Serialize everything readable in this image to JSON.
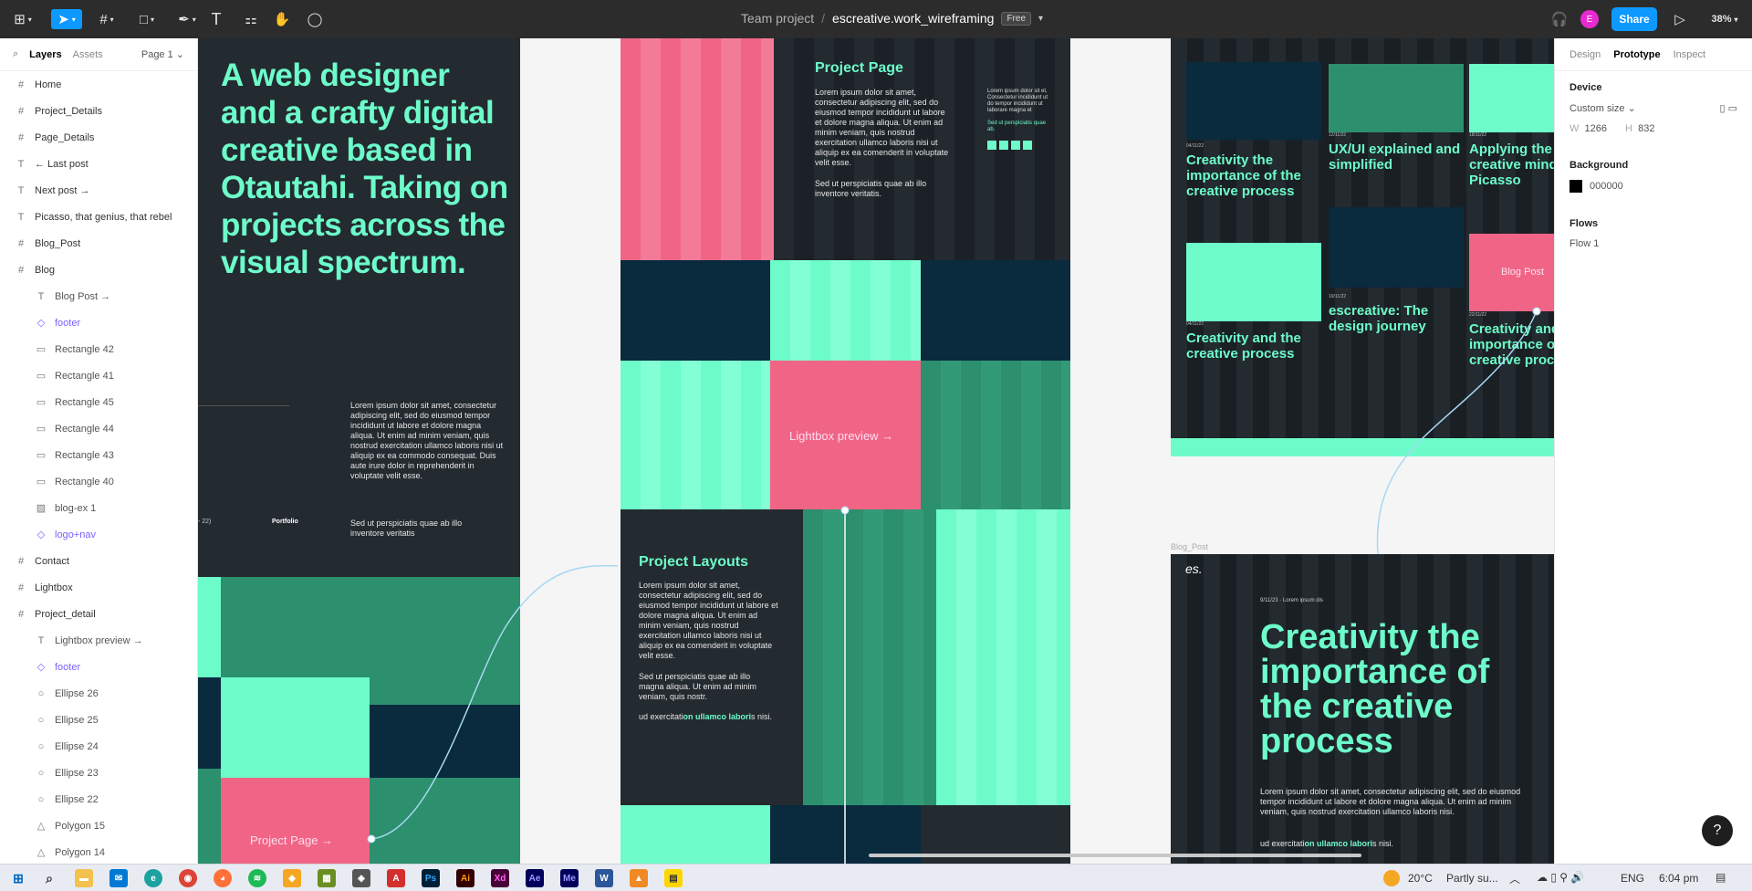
{
  "app": {
    "team": "Team project",
    "separator": "/",
    "file_name": "escreative.work_wireframing",
    "plan_badge": "Free",
    "share_label": "Share",
    "avatar_letter": "E",
    "zoom": "38%"
  },
  "left_panel": {
    "tabs": [
      "Layers",
      "Assets"
    ],
    "page": "Page 1 ⌄",
    "layers": [
      {
        "label": "Home",
        "icon": "#",
        "level": 0
      },
      {
        "label": "Project_Details",
        "icon": "#",
        "level": 0
      },
      {
        "label": "Page_Details",
        "icon": "#",
        "level": 0
      },
      {
        "label": "← Last post",
        "icon": "T",
        "level": 0
      },
      {
        "label": "Next post →",
        "icon": "T",
        "level": 0
      },
      {
        "label": "Picasso, that genius, that rebel",
        "icon": "T",
        "level": 0
      },
      {
        "label": "Blog_Post",
        "icon": "#",
        "level": 0
      },
      {
        "label": "Blog",
        "icon": "#",
        "level": 0
      },
      {
        "label": "Blog Post →",
        "icon": "T",
        "level": 1
      },
      {
        "label": "footer",
        "icon": "◇",
        "level": 1,
        "component": true
      },
      {
        "label": "Rectangle 42",
        "icon": "▭",
        "level": 1
      },
      {
        "label": "Rectangle 41",
        "icon": "▭",
        "level": 1
      },
      {
        "label": "Rectangle 45",
        "icon": "▭",
        "level": 1
      },
      {
        "label": "Rectangle 44",
        "icon": "▭",
        "level": 1
      },
      {
        "label": "Rectangle 43",
        "icon": "▭",
        "level": 1
      },
      {
        "label": "Rectangle 40",
        "icon": "▭",
        "level": 1
      },
      {
        "label": "blog-ex 1",
        "icon": "▨",
        "level": 1
      },
      {
        "label": "logo+nav",
        "icon": "◇",
        "level": 1,
        "component": true
      },
      {
        "label": "Contact",
        "icon": "#",
        "level": 0
      },
      {
        "label": "Lightbox",
        "icon": "#",
        "level": 0
      },
      {
        "label": "Project_detail",
        "icon": "#",
        "level": 0
      },
      {
        "label": "Lightbox preview →",
        "icon": "T",
        "level": 1
      },
      {
        "label": "footer",
        "icon": "◇",
        "level": 1,
        "component": true
      },
      {
        "label": "Ellipse 26",
        "icon": "○",
        "level": 1
      },
      {
        "label": "Ellipse 25",
        "icon": "○",
        "level": 1
      },
      {
        "label": "Ellipse 24",
        "icon": "○",
        "level": 1
      },
      {
        "label": "Ellipse 23",
        "icon": "○",
        "level": 1
      },
      {
        "label": "Ellipse 22",
        "icon": "○",
        "level": 1
      },
      {
        "label": "Polygon 15",
        "icon": "△",
        "level": 1
      },
      {
        "label": "Polygon 14",
        "icon": "△",
        "level": 1
      }
    ]
  },
  "canvas": {
    "home": {
      "headline": "A web designer and a crafty digital creative  based in Otautahi. Taking on projects across the visual spectrum.",
      "body": "Lorem ipsum dolor sit amet, consectetur adipiscing elit, sed do eiusmod tempor incididunt ut labore et dolore magna aliqua. Ut enim ad minim veniam, quis nostrud exercitation ullamco laboris nisi ut aliquip ex ea commodo consequat. Duis aute irure dolor in reprehenderit in voluptate velit esse.",
      "portfolio": "Portfolio",
      "footer_text": "Sed ut perspiciatis quae ab illo inventore veritatis",
      "counter": "- 22)",
      "project_page_link": "Project Page →"
    },
    "project": {
      "page_title": "Project Page",
      "page_body": "Lorem ipsum dolor sit amet, consectetur adipiscing elit, sed do eiusmod tempor incididunt ut labore et dolore magna aliqua. Ut enim ad minim veniam, quis nostrud exercitation ullamco laboris nisi ut aliquip ex ea comenderit in voluptate velit esse.",
      "page_body2": "Sed ut perspiciatis quae ab illo inventore veritatis.",
      "side_text": "Lorem ipsum dolor sit et, Consectetur incididunt ut do tempor incididunt ut laborare magna et",
      "side_link": "Sed ut perspiciatis quae ab.",
      "lightbox_link": "Lightbox preview →",
      "layouts_title": "Project Layouts",
      "layouts_body": "Lorem ipsum dolor sit amet, consectetur adipiscing elit, sed do eiusmod tempor incididunt ut labore et dolore magna aliqua. Ut enim ad minim veniam, quis nostrud exercitation ullamco laboris nisi ut aliquip ex ea comenderit in voluptate velit esse.",
      "layouts_body2": "Sed ut perspiciatis quae ab illo magna aliqua. Ut enim ad minim veniam, quis nostr.",
      "layouts_link_pre": "ud exercitati",
      "layouts_link_bold": "on ullamco labori",
      "layouts_link_post": "s nisi."
    },
    "blog": {
      "cards": [
        {
          "date": "04/11/22",
          "title": "Creativity the importance of the creative process"
        },
        {
          "date": "12/11/22",
          "title": "UX/UI explained and simplified"
        },
        {
          "date": "18/11/22",
          "title": "Applying the creative mindset Picasso"
        },
        {
          "date": "04/11/22",
          "title": "Creativity and the creative process"
        },
        {
          "date": "19/11/22",
          "title": "escreative: The design journey"
        },
        {
          "date": "22/11/22",
          "title": "Creativity and importance of creative proce"
        }
      ],
      "card_tags": [
        "Blog Post"
      ]
    },
    "blog_post": {
      "frame_label": "Blog_Post",
      "logo": "es.",
      "meta": "9/11/23  ·  Lorem ipsum dis",
      "title": "Creativity the importance of the creative process",
      "body": "Lorem ipsum dolor sit amet, consectetur adipiscing elit, sed do eiusmod tempor incididunt ut labore et dolore magna aliqua. Ut enim ad minim veniam, quis nostrud exercitation ullamco laboris nisi.",
      "link_pre": "ud exercitati",
      "link_bold": "on ullamco labori",
      "link_post": "s nisi."
    }
  },
  "right_panel": {
    "tabs": [
      "Design",
      "Prototype",
      "Inspect"
    ],
    "device_heading": "Device",
    "device_value": "Custom size ⌄",
    "w_label": "W",
    "w_value": "1266",
    "h_label": "H",
    "h_value": "832",
    "background_heading": "Background",
    "background_value": "000000",
    "flows_heading": "Flows",
    "flow_item": "Flow 1"
  },
  "taskbar": {
    "temperature": "20°C",
    "weather": "Partly su...",
    "lang": "ENG",
    "time": "6:04 pm"
  },
  "colors": {
    "mint": "#6dfcc9",
    "pink": "#f06586",
    "dark": "#232a30",
    "navy": "#0a2a3d",
    "green": "#2c8f6d",
    "accent": "#0d99ff"
  }
}
